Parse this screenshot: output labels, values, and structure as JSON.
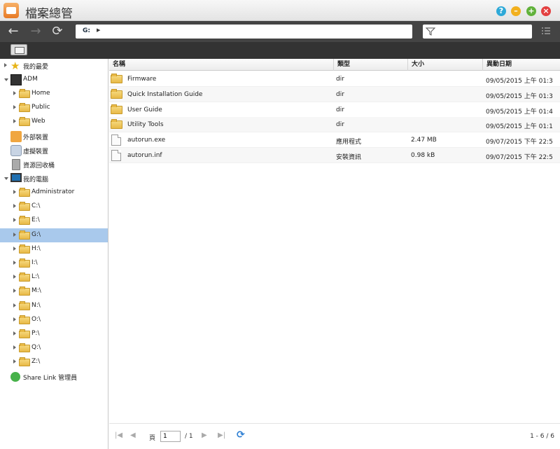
{
  "window": {
    "title": "檔案總管"
  },
  "nav": {
    "path": "G:"
  },
  "sidebar": {
    "favorites": "我的最愛",
    "adm": "ADM",
    "home": "Home",
    "public": "Public",
    "web": "Web",
    "external": "外部裝置",
    "virtual": "虛擬裝置",
    "recycle": "資源回收桶",
    "mycomputer": "我的電腦",
    "drives": [
      "Administrator",
      "C:\\",
      "E:\\",
      "G:\\",
      "H:\\",
      "I:\\",
      "L:\\",
      "M:\\",
      "N:\\",
      "O:\\",
      "P:\\",
      "Q:\\",
      "Z:\\"
    ],
    "selected": "G:\\",
    "sharelink": "Share Link 管理員"
  },
  "table": {
    "columns": [
      "名稱",
      "類型",
      "大小",
      "異動日期"
    ],
    "rows": [
      {
        "name": "Firmware",
        "type": "dir",
        "size": "",
        "modified": "09/05/2015 上午 01:3",
        "kind": "folder"
      },
      {
        "name": "Quick Installation Guide",
        "type": "dir",
        "size": "",
        "modified": "09/05/2015 上午 01:3",
        "kind": "folder"
      },
      {
        "name": "User Guide",
        "type": "dir",
        "size": "",
        "modified": "09/05/2015 上午 01:4",
        "kind": "folder"
      },
      {
        "name": "Utility Tools",
        "type": "dir",
        "size": "",
        "modified": "09/05/2015 上午 01:1",
        "kind": "folder"
      },
      {
        "name": "autorun.exe",
        "type": "應用程式",
        "size": "2.47 MB",
        "modified": "09/07/2015 下午 22:5",
        "kind": "file"
      },
      {
        "name": "autorun.inf",
        "type": "安裝資訊",
        "size": "0.98 kB",
        "modified": "09/07/2015 下午 22:5",
        "kind": "file"
      }
    ]
  },
  "pager": {
    "page_label": "頁",
    "page_value": "1",
    "total": "/ 1",
    "count": "1 - 6 / 6"
  }
}
